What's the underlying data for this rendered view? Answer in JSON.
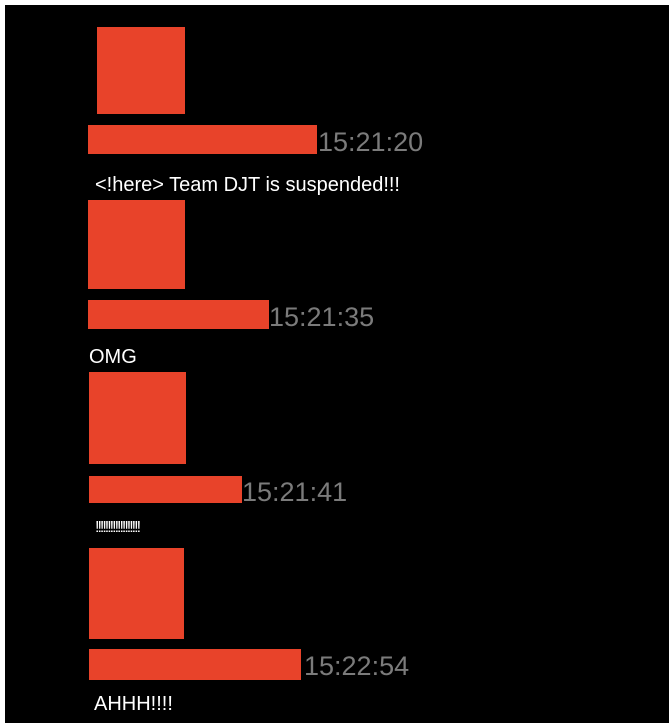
{
  "colors": {
    "background": "#000000",
    "redaction": "#e8432a",
    "timestamp": "#7b7b7b",
    "text": "#ffffff"
  },
  "messages": [
    {
      "timestamp": "15:21:20",
      "text": "<!here> Team DJT is suspended!!!"
    },
    {
      "timestamp": "15:21:35",
      "text": "OMG"
    },
    {
      "timestamp": "15:21:41",
      "text": "!!!!!!!!!!!!!!!!!!"
    },
    {
      "timestamp": "15:22:54",
      "text": "AHHH!!!!"
    }
  ]
}
